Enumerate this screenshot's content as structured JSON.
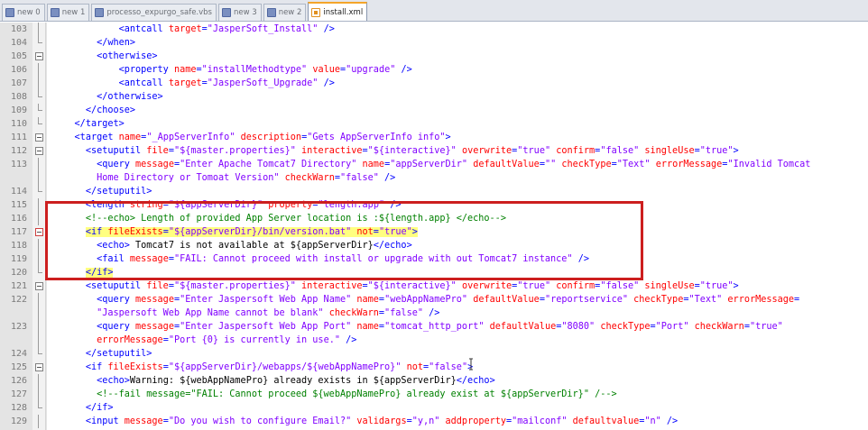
{
  "tabs": [
    {
      "label": "new 0",
      "icon": "file-icon",
      "active": false
    },
    {
      "label": "new 1",
      "icon": "file-icon",
      "active": false
    },
    {
      "label": "processo_expurgo_safe.vbs",
      "icon": "file-icon",
      "active": false
    },
    {
      "label": "new 3",
      "icon": "file-icon",
      "active": false
    },
    {
      "label": "new 2",
      "icon": "file-icon",
      "active": false
    },
    {
      "label": "install.xml",
      "icon": "xml-file-icon",
      "active": true
    }
  ],
  "lines": [
    {
      "n": "103",
      "f": "vline",
      "s": [
        [
          "x",
          "            "
        ],
        [
          "t",
          "<antcall "
        ],
        [
          "a",
          "target"
        ],
        [
          "t",
          "="
        ],
        [
          "v",
          "\"JasperSoft_Install\""
        ],
        [
          "t",
          " />"
        ]
      ]
    },
    {
      "n": "104",
      "f": "end",
      "s": [
        [
          "x",
          "        "
        ],
        [
          "t",
          "</when>"
        ]
      ]
    },
    {
      "n": "105",
      "f": "box",
      "s": [
        [
          "x",
          "        "
        ],
        [
          "t",
          "<otherwise>"
        ]
      ]
    },
    {
      "n": "106",
      "f": "vline",
      "s": [
        [
          "x",
          "            "
        ],
        [
          "t",
          "<property "
        ],
        [
          "a",
          "name"
        ],
        [
          "t",
          "="
        ],
        [
          "v",
          "\"installMethodtype\""
        ],
        [
          "t",
          " "
        ],
        [
          "a",
          "value"
        ],
        [
          "t",
          "="
        ],
        [
          "v",
          "\"upgrade\""
        ],
        [
          "t",
          " />"
        ]
      ]
    },
    {
      "n": "107",
      "f": "vline",
      "s": [
        [
          "x",
          "            "
        ],
        [
          "t",
          "<antcall "
        ],
        [
          "a",
          "target"
        ],
        [
          "t",
          "="
        ],
        [
          "v",
          "\"JasperSoft_Upgrade\""
        ],
        [
          "t",
          " />"
        ]
      ]
    },
    {
      "n": "108",
      "f": "end",
      "s": [
        [
          "x",
          "        "
        ],
        [
          "t",
          "</otherwise>"
        ]
      ]
    },
    {
      "n": "109",
      "f": "end",
      "s": [
        [
          "x",
          "      "
        ],
        [
          "t",
          "</choose>"
        ]
      ]
    },
    {
      "n": "110",
      "f": "end",
      "s": [
        [
          "x",
          "    "
        ],
        [
          "t",
          "</target>"
        ]
      ]
    },
    {
      "n": "111",
      "f": "box",
      "s": [
        [
          "x",
          "    "
        ],
        [
          "t",
          "<target "
        ],
        [
          "a",
          "name"
        ],
        [
          "t",
          "="
        ],
        [
          "v",
          "\"_AppServerInfo\""
        ],
        [
          "t",
          " "
        ],
        [
          "a",
          "description"
        ],
        [
          "t",
          "="
        ],
        [
          "v",
          "\"Gets AppServerInfo info\""
        ],
        [
          "t",
          ">"
        ]
      ]
    },
    {
      "n": "112",
      "f": "box",
      "s": [
        [
          "x",
          "      "
        ],
        [
          "t",
          "<setuputil "
        ],
        [
          "a",
          "file"
        ],
        [
          "t",
          "="
        ],
        [
          "v",
          "\"${master.properties}\""
        ],
        [
          "t",
          " "
        ],
        [
          "a",
          "interactive"
        ],
        [
          "t",
          "="
        ],
        [
          "v",
          "\"${interactive}\""
        ],
        [
          "t",
          " "
        ],
        [
          "a",
          "overwrite"
        ],
        [
          "t",
          "="
        ],
        [
          "v",
          "\"true\""
        ],
        [
          "t",
          " "
        ],
        [
          "a",
          "confirm"
        ],
        [
          "t",
          "="
        ],
        [
          "v",
          "\"false\""
        ],
        [
          "t",
          " "
        ],
        [
          "a",
          "singleUse"
        ],
        [
          "t",
          "="
        ],
        [
          "v",
          "\"true\""
        ],
        [
          "t",
          ">"
        ]
      ]
    },
    {
      "n": "113",
      "f": "vline",
      "s": [
        [
          "x",
          "        "
        ],
        [
          "t",
          "<query "
        ],
        [
          "a",
          "message"
        ],
        [
          "t",
          "="
        ],
        [
          "v",
          "\"Enter Apache Tomcat7 Directory\""
        ],
        [
          "t",
          " "
        ],
        [
          "a",
          "name"
        ],
        [
          "t",
          "="
        ],
        [
          "v",
          "\"appServerDir\""
        ],
        [
          "t",
          " "
        ],
        [
          "a",
          "defaultValue"
        ],
        [
          "t",
          "="
        ],
        [
          "v",
          "\"\""
        ],
        [
          "t",
          " "
        ],
        [
          "a",
          "checkType"
        ],
        [
          "t",
          "="
        ],
        [
          "v",
          "\"Text\""
        ],
        [
          "t",
          " "
        ],
        [
          "a",
          "errorMessage"
        ],
        [
          "t",
          "="
        ],
        [
          "v",
          "\"Invalid Tomcat"
        ]
      ]
    },
    {
      "n": "",
      "f": "vline",
      "s": [
        [
          "v",
          "        Home Directory or Tomoat Version\""
        ],
        [
          "t",
          " "
        ],
        [
          "a",
          "checkWarn"
        ],
        [
          "t",
          "="
        ],
        [
          "v",
          "\"false\""
        ],
        [
          "t",
          " />"
        ]
      ]
    },
    {
      "n": "114",
      "f": "end",
      "s": [
        [
          "x",
          "      "
        ],
        [
          "t",
          "</setuputil>"
        ]
      ]
    },
    {
      "n": "115",
      "f": "vline",
      "s": [
        [
          "x",
          "      "
        ],
        [
          "t",
          "<length "
        ],
        [
          "a",
          "string"
        ],
        [
          "t",
          "="
        ],
        [
          "v",
          "\"${appServerDir}\""
        ],
        [
          "t",
          " "
        ],
        [
          "a",
          "property"
        ],
        [
          "t",
          "="
        ],
        [
          "v",
          "\"length.app\""
        ],
        [
          "t",
          " />"
        ]
      ]
    },
    {
      "n": "116",
      "f": "vline",
      "s": [
        [
          "x",
          "      "
        ],
        [
          "c",
          "<!--echo> Length of provided App Server location is :${length.app} </echo-->"
        ]
      ]
    },
    {
      "n": "117",
      "f": "boxred",
      "s": [
        [
          "x",
          "      "
        ],
        [
          "th",
          "<if "
        ],
        [
          "ah",
          "fileExists"
        ],
        [
          "th",
          "="
        ],
        [
          "vh",
          "\"${appServerDir}/bin/version.bat\""
        ],
        [
          "th",
          " "
        ],
        [
          "ah",
          "not"
        ],
        [
          "th",
          "="
        ],
        [
          "vh",
          "\"true\""
        ],
        [
          "th",
          ">"
        ]
      ]
    },
    {
      "n": "118",
      "f": "vline",
      "s": [
        [
          "x",
          "        "
        ],
        [
          "t",
          "<echo>"
        ],
        [
          "x",
          " Tomcat7 is not available at ${appServerDir}"
        ],
        [
          "t",
          "</echo>"
        ]
      ]
    },
    {
      "n": "119",
      "f": "vline",
      "s": [
        [
          "x",
          "        "
        ],
        [
          "t",
          "<fail "
        ],
        [
          "a",
          "message"
        ],
        [
          "t",
          "="
        ],
        [
          "v",
          "\"FAIL: Cannot proceed with install or upgrade with out Tomcat7 instance\""
        ],
        [
          "t",
          " />"
        ]
      ]
    },
    {
      "n": "120",
      "f": "end",
      "s": [
        [
          "x",
          "      "
        ],
        [
          "th",
          "</if>"
        ]
      ]
    },
    {
      "n": "121",
      "f": "box",
      "s": [
        [
          "x",
          "      "
        ],
        [
          "t",
          "<setuputil "
        ],
        [
          "a",
          "file"
        ],
        [
          "t",
          "="
        ],
        [
          "v",
          "\"${master.properties}\""
        ],
        [
          "t",
          " "
        ],
        [
          "a",
          "interactive"
        ],
        [
          "t",
          "="
        ],
        [
          "v",
          "\"${interactive}\""
        ],
        [
          "t",
          " "
        ],
        [
          "a",
          "overwrite"
        ],
        [
          "t",
          "="
        ],
        [
          "v",
          "\"true\""
        ],
        [
          "t",
          " "
        ],
        [
          "a",
          "confirm"
        ],
        [
          "t",
          "="
        ],
        [
          "v",
          "\"false\""
        ],
        [
          "t",
          " "
        ],
        [
          "a",
          "singleUse"
        ],
        [
          "t",
          "="
        ],
        [
          "v",
          "\"true\""
        ],
        [
          "t",
          ">"
        ]
      ]
    },
    {
      "n": "122",
      "f": "vline",
      "s": [
        [
          "x",
          "        "
        ],
        [
          "t",
          "<query "
        ],
        [
          "a",
          "message"
        ],
        [
          "t",
          "="
        ],
        [
          "v",
          "\"Enter Jaspersoft Web App Name\""
        ],
        [
          "t",
          " "
        ],
        [
          "a",
          "name"
        ],
        [
          "t",
          "="
        ],
        [
          "v",
          "\"webAppNamePro\""
        ],
        [
          "t",
          " "
        ],
        [
          "a",
          "defaultValue"
        ],
        [
          "t",
          "="
        ],
        [
          "v",
          "\"reportservice\""
        ],
        [
          "t",
          " "
        ],
        [
          "a",
          "checkType"
        ],
        [
          "t",
          "="
        ],
        [
          "v",
          "\"Text\""
        ],
        [
          "t",
          " "
        ],
        [
          "a",
          "errorMessage"
        ],
        [
          "t",
          "="
        ]
      ]
    },
    {
      "n": "",
      "f": "vline",
      "s": [
        [
          "v",
          "        \"Jaspersoft Web App Name cannot be blank\""
        ],
        [
          "t",
          " "
        ],
        [
          "a",
          "checkWarn"
        ],
        [
          "t",
          "="
        ],
        [
          "v",
          "\"false\""
        ],
        [
          "t",
          " />"
        ]
      ]
    },
    {
      "n": "123",
      "f": "vline",
      "s": [
        [
          "x",
          "        "
        ],
        [
          "t",
          "<query "
        ],
        [
          "a",
          "message"
        ],
        [
          "t",
          "="
        ],
        [
          "v",
          "\"Enter Jaspersoft Web App Port\""
        ],
        [
          "t",
          " "
        ],
        [
          "a",
          "name"
        ],
        [
          "t",
          "="
        ],
        [
          "v",
          "\"tomcat_http_port\""
        ],
        [
          "t",
          " "
        ],
        [
          "a",
          "defaultValue"
        ],
        [
          "t",
          "="
        ],
        [
          "v",
          "\"8080\""
        ],
        [
          "t",
          " "
        ],
        [
          "a",
          "checkType"
        ],
        [
          "t",
          "="
        ],
        [
          "v",
          "\"Port\""
        ],
        [
          "t",
          " "
        ],
        [
          "a",
          "checkWarn"
        ],
        [
          "t",
          "="
        ],
        [
          "v",
          "\"true\""
        ]
      ]
    },
    {
      "n": "",
      "f": "vline",
      "s": [
        [
          "x",
          "        "
        ],
        [
          "a",
          "errorMessage"
        ],
        [
          "t",
          "="
        ],
        [
          "v",
          "\"Port {0} is currently in use.\""
        ],
        [
          "t",
          " />"
        ]
      ]
    },
    {
      "n": "124",
      "f": "end",
      "s": [
        [
          "x",
          "      "
        ],
        [
          "t",
          "</setuputil>"
        ]
      ]
    },
    {
      "n": "125",
      "f": "box",
      "s": [
        [
          "x",
          "      "
        ],
        [
          "t",
          "<if "
        ],
        [
          "a",
          "fileExists"
        ],
        [
          "t",
          "="
        ],
        [
          "v",
          "\"${appServerDir}/webapps/${webAppNamePro}\""
        ],
        [
          "t",
          " "
        ],
        [
          "a",
          "not"
        ],
        [
          "t",
          "="
        ],
        [
          "v",
          "\"false\""
        ],
        [
          "t",
          ">"
        ]
      ]
    },
    {
      "n": "126",
      "f": "vline",
      "s": [
        [
          "x",
          "        "
        ],
        [
          "t",
          "<echo>"
        ],
        [
          "x",
          "Warning: ${webAppNamePro} already exists in ${appServerDir}"
        ],
        [
          "t",
          "</echo>"
        ]
      ]
    },
    {
      "n": "127",
      "f": "vline",
      "s": [
        [
          "x",
          "        "
        ],
        [
          "c",
          "<!--fail message=\"FAIL: Cannot proceed ${webAppNamePro} already exist at ${appServerDir}\" /-->"
        ]
      ]
    },
    {
      "n": "128",
      "f": "end",
      "s": [
        [
          "x",
          "      "
        ],
        [
          "t",
          "</if>"
        ]
      ]
    },
    {
      "n": "129",
      "f": "vline",
      "s": [
        [
          "x",
          "      "
        ],
        [
          "t",
          "<input "
        ],
        [
          "a",
          "message"
        ],
        [
          "t",
          "="
        ],
        [
          "v",
          "\"Do you wish to configure Email?\""
        ],
        [
          "t",
          " "
        ],
        [
          "a",
          "validargs"
        ],
        [
          "t",
          "="
        ],
        [
          "v",
          "\"y,n\""
        ],
        [
          "t",
          " "
        ],
        [
          "a",
          "addproperty"
        ],
        [
          "t",
          "="
        ],
        [
          "v",
          "\"mailconf\""
        ],
        [
          "t",
          " "
        ],
        [
          "a",
          "defaultvalue"
        ],
        [
          "t",
          "="
        ],
        [
          "v",
          "\"n\""
        ],
        [
          "t",
          " />"
        ]
      ]
    }
  ],
  "colors": {
    "tag": "#0000ff",
    "attribute": "#ff0000",
    "value": "#8000ff",
    "comment": "#008000",
    "highlight": "#ffff80",
    "annotation_box": "#cc1f1f"
  }
}
